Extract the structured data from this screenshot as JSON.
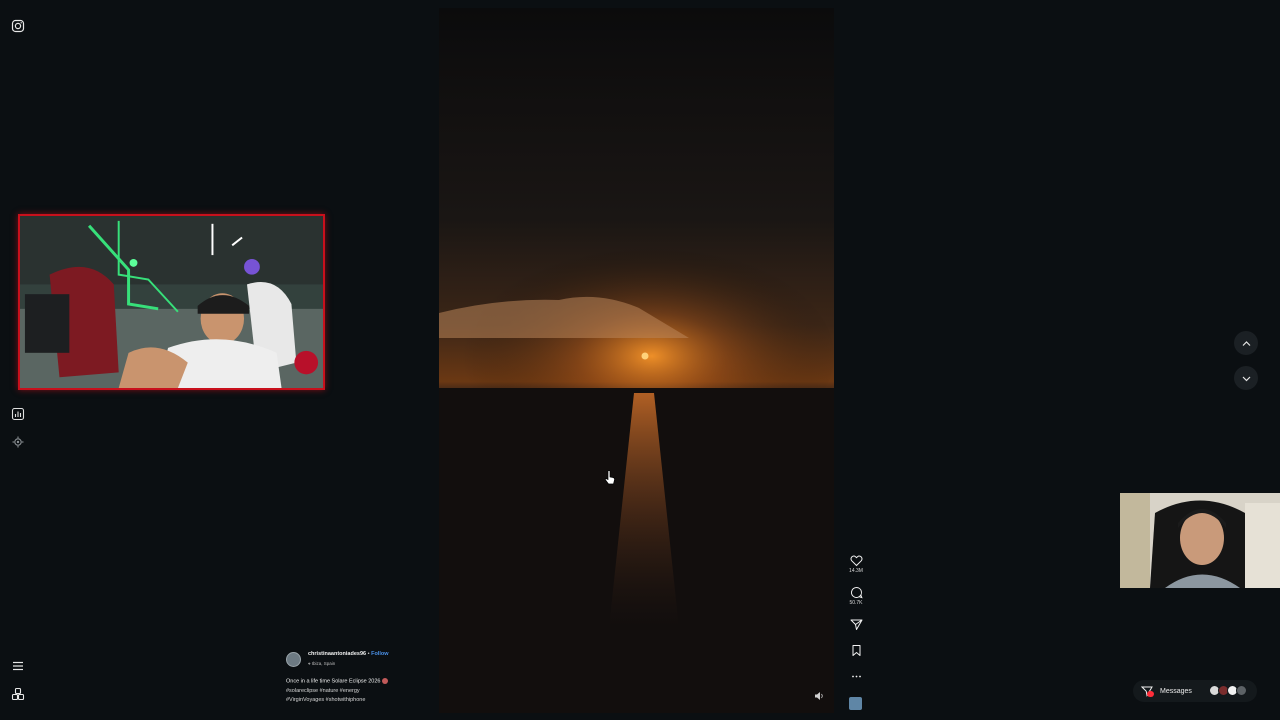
{
  "left_rail": {
    "icons": [
      "instagram-icon",
      "insights-icon",
      "settings-gear-icon",
      "menu-icon",
      "more-apps-icon"
    ]
  },
  "reel": {
    "video_description_icon": "sunset-over-sea",
    "muted_icon": "speaker-icon"
  },
  "actions": {
    "likes": "14.3M",
    "comments": "50.7K",
    "share_icon": "paper-plane-icon",
    "save_icon": "bookmark-icon",
    "more_icon": "more-dots-icon"
  },
  "caption": {
    "username": "christinaantoniades96",
    "separator": "•",
    "follow_label": "Follow",
    "location": "Ibiza, Spain",
    "text": "Once in a life time Solare Eclipse 2026",
    "hashtags_line1": "#solareclipse #nature #energy",
    "hashtags_line2": "#VirginVoyages #shotwithiphone"
  },
  "navigation": {
    "up_icon": "chevron-up-icon",
    "down_icon": "chevron-down-icon"
  },
  "messages": {
    "label": "Messages"
  },
  "colors": {
    "background": "#0b0f12",
    "follow_link": "#4b91e8",
    "stream_border": "#c8101c",
    "notification_badge": "#ff2d3a"
  }
}
